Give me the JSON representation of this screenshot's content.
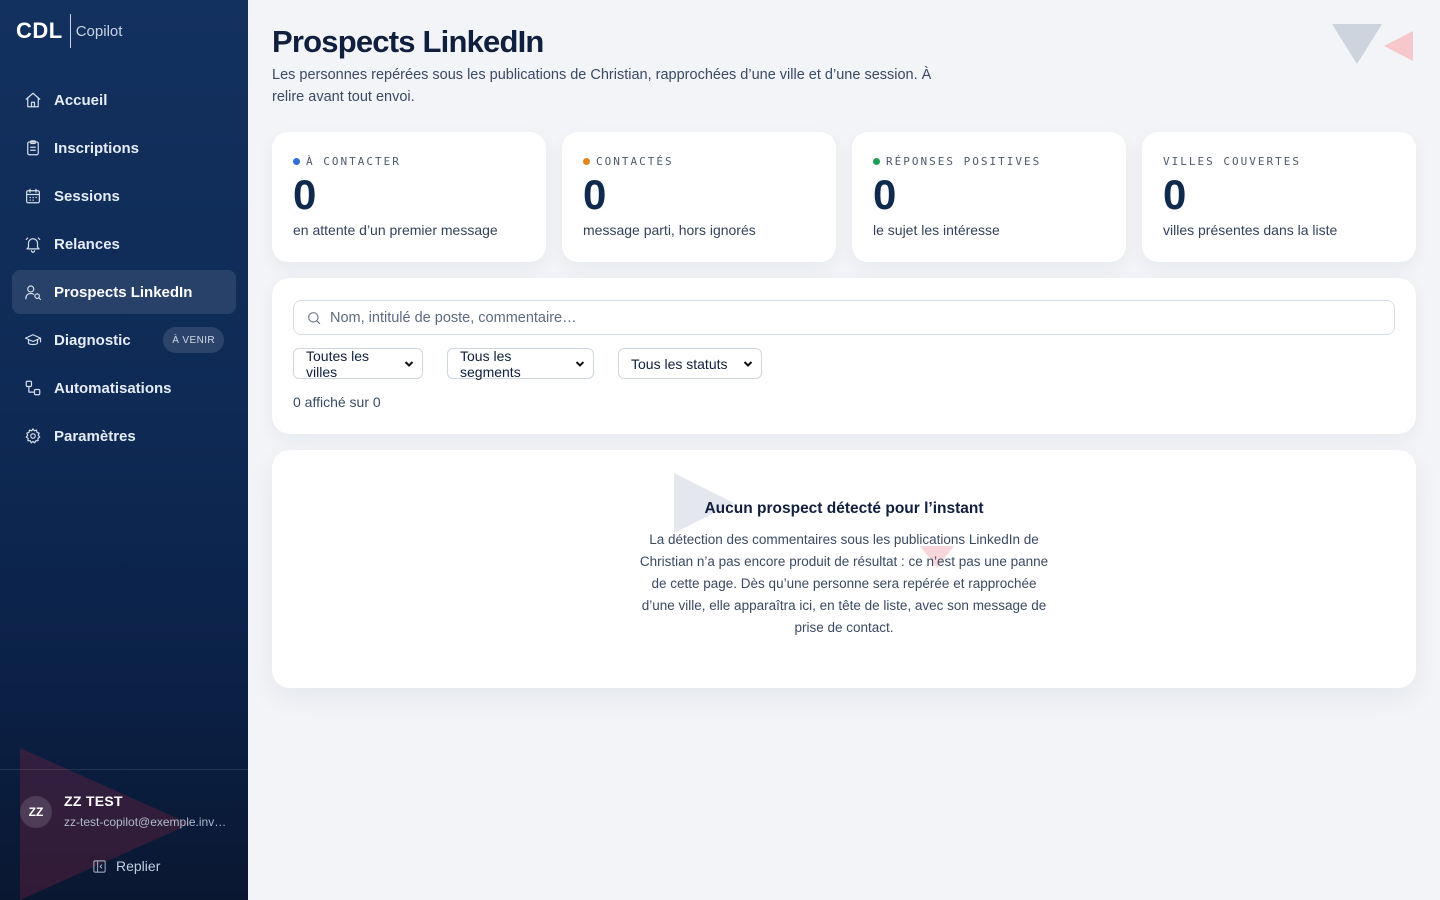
{
  "brand": {
    "name": "CDL",
    "product": "Copilot"
  },
  "sidebar": {
    "items": [
      {
        "label": "Accueil",
        "icon": "home-icon"
      },
      {
        "label": "Inscriptions",
        "icon": "clipboard-icon"
      },
      {
        "label": "Sessions",
        "icon": "calendar-icon"
      },
      {
        "label": "Relances",
        "icon": "bell-icon"
      },
      {
        "label": "Prospects LinkedIn",
        "icon": "user-search-icon",
        "active": true
      },
      {
        "label": "Diagnostic",
        "icon": "graduation-cap-icon",
        "badge": "À VENIR"
      },
      {
        "label": "Automatisations",
        "icon": "workflow-icon"
      },
      {
        "label": "Paramètres",
        "icon": "gear-icon"
      }
    ],
    "user": {
      "initials": "ZZ",
      "name": "ZZ TEST",
      "email": "zz-test-copilot@exemple.invalid"
    },
    "collapse_label": "Replier"
  },
  "header": {
    "title": "Prospects LinkedIn",
    "subtitle": "Les personnes repérées sous les publications de Christian, rapprochées d’une ville et d’une session. À relire avant tout envoi."
  },
  "stats": [
    {
      "label": "À contacter",
      "value": "0",
      "desc": "en attente d’un premier message",
      "dot_color": "#2f6fd6"
    },
    {
      "label": "Contactés",
      "value": "0",
      "desc": "message parti, hors ignorés",
      "dot_color": "#e0861f"
    },
    {
      "label": "Réponses positives",
      "value": "0",
      "desc": "le sujet les intéresse",
      "dot_color": "#1f9d55"
    },
    {
      "label": "Villes couvertes",
      "value": "0",
      "desc": "villes présentes dans la liste"
    }
  ],
  "filters": {
    "search_placeholder": "Nom, intitulé de poste, commentaire…",
    "city": "Toutes les villes",
    "segment": "Tous les segments",
    "status": "Tous les statuts",
    "count_text": "0 affiché sur 0"
  },
  "empty_state": {
    "title": "Aucun prospect détecté pour l’instant",
    "text": "La détection des commentaires sous les publications LinkedIn de Christian n’a pas encore produit de résultat : ce n’est pas une panne de cette page. Dès qu’une personne sera repérée et rapprochée d’une ville, elle apparaîtra ici, en tête de liste, avec son message de prise de contact."
  }
}
